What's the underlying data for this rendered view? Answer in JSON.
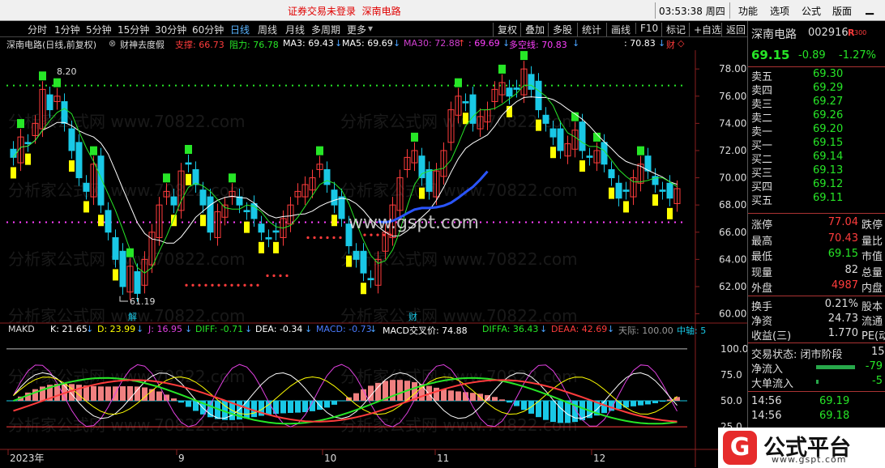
{
  "titlebar": {
    "warning": "证券交易未登录",
    "stock_name": "深南电路",
    "time": "03:53:38",
    "weekday": "周四",
    "menus": [
      "功能",
      "选项",
      "公式",
      "版面"
    ]
  },
  "tabs": [
    {
      "label": "分时",
      "active": false
    },
    {
      "label": "1分钟",
      "active": false
    },
    {
      "label": "5分钟",
      "active": false
    },
    {
      "label": "15分钟",
      "active": false
    },
    {
      "label": "30分钟",
      "active": false
    },
    {
      "label": "60分钟",
      "active": false
    },
    {
      "label": "日线",
      "active": true
    },
    {
      "label": "周线",
      "active": false
    },
    {
      "label": "月线",
      "active": false
    },
    {
      "label": "多周期",
      "active": false
    },
    {
      "label": "更多",
      "active": false
    }
  ],
  "tools": [
    "复权",
    "叠加",
    "多股",
    "统计",
    "画线",
    "F10",
    "标记",
    "+自选",
    "返回"
  ],
  "indicator_line": {
    "stock": "深南电路(日线,前复权)",
    "formula": "财神去度假",
    "support": "支撑: 66.73",
    "resistance": "阻力: 76.78",
    "ma3": "MA3: 69.43",
    "ma5": "MA5: 69.69",
    "ma30": "MA30: 72.88",
    "val1": ": 69.69",
    "duokong": "多空线: 70.83",
    "val2": ": 70.83",
    "cai": "财",
    "colors": {
      "support": "#ff3c3c",
      "resistance": "#27e627",
      "ma3": "#ffffff",
      "ma5": "#ffffff",
      "ma30": "#d040d0",
      "duokong": "#ff40ff",
      "val2": "#ffffff"
    }
  },
  "price_axis": [
    "78.00",
    "76.00",
    "74.00",
    "72.00",
    "70.00",
    "68.00",
    "66.00",
    "64.00",
    "62.00",
    "60.00"
  ],
  "annotations": {
    "high_label": "8.20",
    "low_label": "61.19",
    "jie": "解",
    "cai": "财"
  },
  "sub_header": {
    "name": "MAKD",
    "k": "K: 21.65",
    "d": "D: 23.99",
    "j": "J: 16.95",
    "diff": "DIFF: -0.71",
    "dea": "DEA: -0.34",
    "macd": "MACD: -0.73",
    "macd_cross": "MACD交叉价: 74.88",
    "diffa": "DIFFA: 36.43",
    "deaa": "DEAA: 42.69",
    "tianji": "天际: 100.00",
    "zhongzhou": "中轴: 5"
  },
  "sub_axis": [
    "100.0",
    "75.0",
    "50.0",
    "25.0"
  ],
  "x_axis": [
    "2023年",
    "9",
    "10",
    "11",
    "12"
  ],
  "right_panel": {
    "name": "深南电路",
    "code": "002916",
    "badge": "R",
    "badge_num": "300",
    "price": "69.15",
    "change": "-0.89",
    "change_pct": "-1.27%",
    "sells": [
      {
        "label": "卖五",
        "price": "69.30"
      },
      {
        "label": "卖四",
        "price": "69.29"
      },
      {
        "label": "卖三",
        "price": "69.27"
      },
      {
        "label": "卖二",
        "price": "69.26"
      },
      {
        "label": "卖一",
        "price": "69.20"
      }
    ],
    "buys": [
      {
        "label": "买一",
        "price": "69.15"
      },
      {
        "label": "买二",
        "price": "69.14"
      },
      {
        "label": "买三",
        "price": "69.13"
      },
      {
        "label": "买四",
        "price": "69.12"
      },
      {
        "label": "买五",
        "price": "69.11"
      }
    ],
    "stats": [
      {
        "label": "涨停",
        "value": "77.04",
        "right": "跌停",
        "color": "#ff3c3c"
      },
      {
        "label": "最高",
        "value": "70.43",
        "right": "量比",
        "color": "#ff3c3c"
      },
      {
        "label": "最低",
        "value": "69.15",
        "right": "市值",
        "color": "#27e627"
      },
      {
        "label": "现量",
        "value": "82",
        "right": "总量",
        "color": "#dddddd"
      },
      {
        "label": "外盘",
        "value": "4987",
        "right": "内盘",
        "color": "#ff3c3c"
      }
    ],
    "stats2": [
      {
        "label": "换手",
        "value": "0.21%",
        "right": "股本"
      },
      {
        "label": "净资",
        "value": "24.73",
        "right": "流通"
      },
      {
        "label": "收益(三)",
        "value": "1.770",
        "right": "PE(动"
      }
    ],
    "trade_status": "交易状态: 闭市阶段",
    "trade_status_num": "15",
    "net_inflow": {
      "label": "净流入",
      "value": "-79"
    },
    "big_inflow": {
      "label": "大单流入",
      "value": "-5"
    },
    "ticks": [
      {
        "time": "14:56",
        "price": "69.19"
      },
      {
        "time": "14:56",
        "price": "69.18"
      }
    ]
  },
  "watermark_text": "分析家公式网 www.70822.com",
  "center_watermark": "www.gspt.com",
  "logo": {
    "mark": "G",
    "name": "公式平台",
    "url": "www.gspt.com"
  },
  "colors": {
    "up": "#ff3c3c",
    "down": "#27e627",
    "cyan": "#19c8e6",
    "yellow": "#ffff00",
    "panel_blue": "#3a7bd5"
  }
}
